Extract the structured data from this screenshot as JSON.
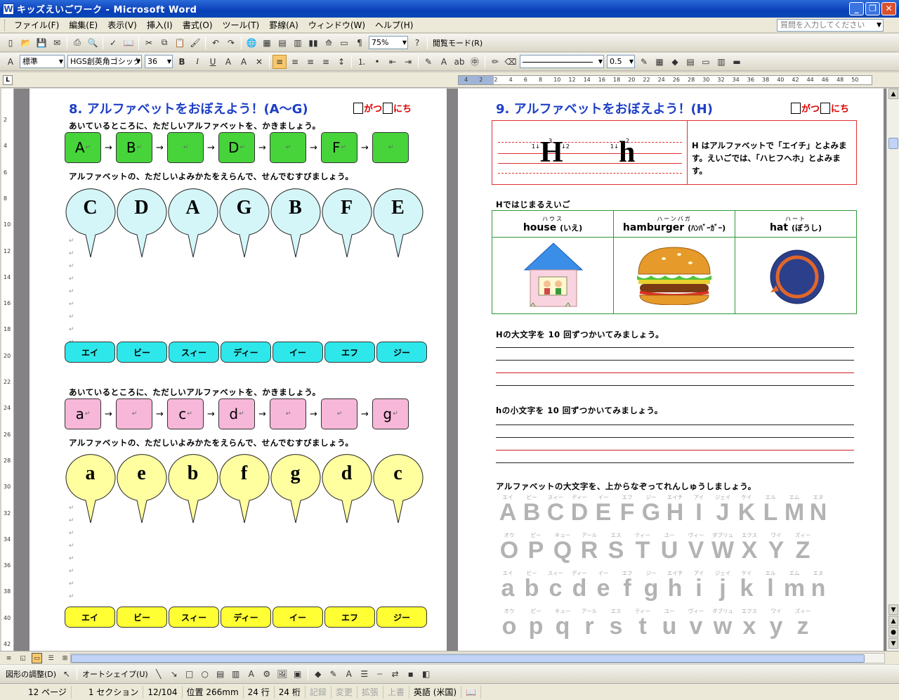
{
  "window": {
    "title": "キッズえいごワーク - Microsoft Word",
    "help_placeholder": "質問を入力してください"
  },
  "menu": [
    "ファイル(F)",
    "編集(E)",
    "表示(V)",
    "挿入(I)",
    "書式(O)",
    "ツール(T)",
    "罫線(A)",
    "ウィンドウ(W)",
    "ヘルプ(H)"
  ],
  "toolbar1": {
    "zoom": "75%",
    "reading_mode": "閲覧モード(R)"
  },
  "toolbar2": {
    "style": "標準",
    "font": "HGS創英角ゴシック",
    "size": "36",
    "line_width": "0.5"
  },
  "ruler_numbers": [
    "4",
    "2",
    "2",
    "4",
    "6",
    "8",
    "10",
    "12",
    "14",
    "16",
    "18",
    "20",
    "22",
    "24",
    "26",
    "28",
    "30",
    "32",
    "34",
    "36",
    "38",
    "40",
    "42",
    "44",
    "46",
    "48",
    "50"
  ],
  "vruler_numbers": [
    "2",
    "4",
    "6",
    "8",
    "10",
    "12",
    "14",
    "16",
    "18",
    "20",
    "22",
    "24",
    "26",
    "28",
    "30",
    "32",
    "34",
    "36",
    "38",
    "40",
    "42"
  ],
  "left_page": {
    "title": "8. アルファベットをおぼえよう！(A～G)",
    "date_month": "がつ",
    "date_day": "にち",
    "instr1": "あいているところに、ただしいアルファベットを、かきましょう。",
    "upper_boxes": [
      "A",
      "B",
      "",
      "D",
      "",
      "F",
      ""
    ],
    "instr2": "アルファベットの、ただしいよみかたをえらんで、せんでむすびましょう。",
    "upper_bubbles": [
      "C",
      "D",
      "A",
      "G",
      "B",
      "F",
      "E"
    ],
    "katakana": [
      "エイ",
      "ビー",
      "スィー",
      "ディー",
      "イー",
      "エフ",
      "ジー"
    ],
    "instr3": "あいているところに、ただしいアルファベットを、かきましょう。",
    "lower_boxes": [
      "a",
      "",
      "c",
      "d",
      "",
      "",
      "g"
    ],
    "instr4": "アルファベットの、ただしいよみかたをえらんで、せんでむすびましょう。",
    "lower_bubbles": [
      "a",
      "e",
      "b",
      "f",
      "g",
      "d",
      "c"
    ],
    "katakana2": [
      "エイ",
      "ビー",
      "スィー",
      "ディー",
      "イー",
      "エフ",
      "ジー"
    ]
  },
  "right_page": {
    "title": "9. アルファベットをおぼえよう！(H)",
    "date_month": "がつ",
    "date_day": "にち",
    "big_upper": "H",
    "big_lower": "h",
    "stroke_notes": [
      "1↓",
      "3",
      "↓2",
      "1↓",
      "2"
    ],
    "description": "H はアルファベットで「エイチ」とよみます。えいごでは、「ハヒフヘホ」とよみます。",
    "words_heading": "Hではじまるえいご",
    "words": [
      {
        "ruby": "ハウス",
        "word": "house",
        "meaning": "(いえ)",
        "icon": "house-icon"
      },
      {
        "ruby": "ハーンバガ",
        "word": "hamburger",
        "meaning": "(ﾊﾝﾊﾞｰｶﾞｰ)",
        "icon": "hamburger-icon"
      },
      {
        "ruby": "ハート",
        "word": "hat",
        "meaning": "(ぼうし)",
        "icon": "hat-icon"
      }
    ],
    "practice_upper": "Hの大文字を 10 回ずつかいてみましょう。",
    "practice_lower": "hの小文字を 10 回ずつかいてみましょう。",
    "trace_instr": "アルファベットの大文字を、上からなぞってれんしゅうしましょう。",
    "kana_row1": [
      "エイ",
      "ビー",
      "スィー",
      "ディー",
      "イー",
      "エフ",
      "ジー",
      "エイチ",
      "アイ",
      "ジェイ",
      "ケイ",
      "エル",
      "エム",
      "エヌ"
    ],
    "upper_row1": [
      "A",
      "B",
      "C",
      "D",
      "E",
      "F",
      "G",
      "H",
      "I",
      "J",
      "K",
      "L",
      "M",
      "N"
    ],
    "kana_row2": [
      "オウ",
      "ピー",
      "キュー",
      "アール",
      "エス",
      "ティー",
      "ユー",
      "ヴィー",
      "ダブリュ",
      "エクス",
      "ワイ",
      "ズィー"
    ],
    "upper_row2": [
      "O",
      "P",
      "Q",
      "R",
      "S",
      "T",
      "U",
      "V",
      "W",
      "X",
      "Y",
      "Z"
    ],
    "kana_row3": [
      "エイ",
      "ビー",
      "スィー",
      "ディー",
      "イー",
      "エフ",
      "ジー",
      "エイチ",
      "アイ",
      "ジェイ",
      "ケイ",
      "エル",
      "エム",
      "エヌ"
    ],
    "lower_row1": [
      "a",
      "b",
      "c",
      "d",
      "e",
      "f",
      "g",
      "h",
      "i",
      "j",
      "k",
      "l",
      "m",
      "n"
    ],
    "kana_row4": [
      "オウ",
      "ピー",
      "キュー",
      "アール",
      "エス",
      "ティー",
      "ユー",
      "ヴィー",
      "ダブリュ",
      "エクス",
      "ワイ",
      "ズィー"
    ],
    "lower_row2": [
      "o",
      "p",
      "q",
      "r",
      "s",
      "t",
      "u",
      "v",
      "w",
      "x",
      "y",
      "z"
    ]
  },
  "drawing_toolbar": {
    "adjust": "図形の調整(D)",
    "autoshape": "オートシェイプ(U)"
  },
  "status": {
    "page": "12 ページ",
    "section": "1 セクション",
    "pages": "12/104",
    "position": "位置 266mm",
    "line": "24 行",
    "col": "24 桁",
    "rec": "記録",
    "trk": "変更",
    "ext": "拡張",
    "ovr": "上書",
    "lang": "英語 (米国)"
  },
  "colors": {
    "title_blue": "#1d3fc7",
    "date_red": "#e00000",
    "green_box": "#46d43a",
    "pink_box": "#f7b7d9",
    "bubble_cyan": "#d4f6f8",
    "bubble_yellow": "#ffffa0",
    "cyan_box": "#2ee7ea",
    "yellow_box": "#ffff33"
  }
}
